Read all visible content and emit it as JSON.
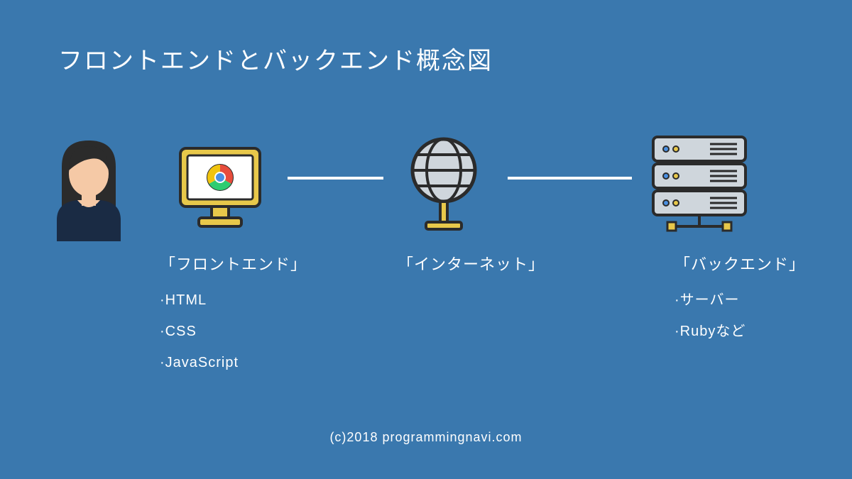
{
  "title": "フロントエンドとバックエンド概念図",
  "frontend": {
    "heading": "「フロントエンド」",
    "items": [
      "·HTML",
      "·CSS",
      "·JavaScript"
    ]
  },
  "internet": {
    "heading": "「インターネット」"
  },
  "backend": {
    "heading": "「バックエンド」",
    "items": [
      "·サーバー",
      "·Rubyなど"
    ]
  },
  "footer": "(c)2018 programmingnavi.com",
  "icons": {
    "user": "user-avatar",
    "browser": "chrome-monitor",
    "globe": "internet-globe",
    "servers": "server-rack"
  }
}
